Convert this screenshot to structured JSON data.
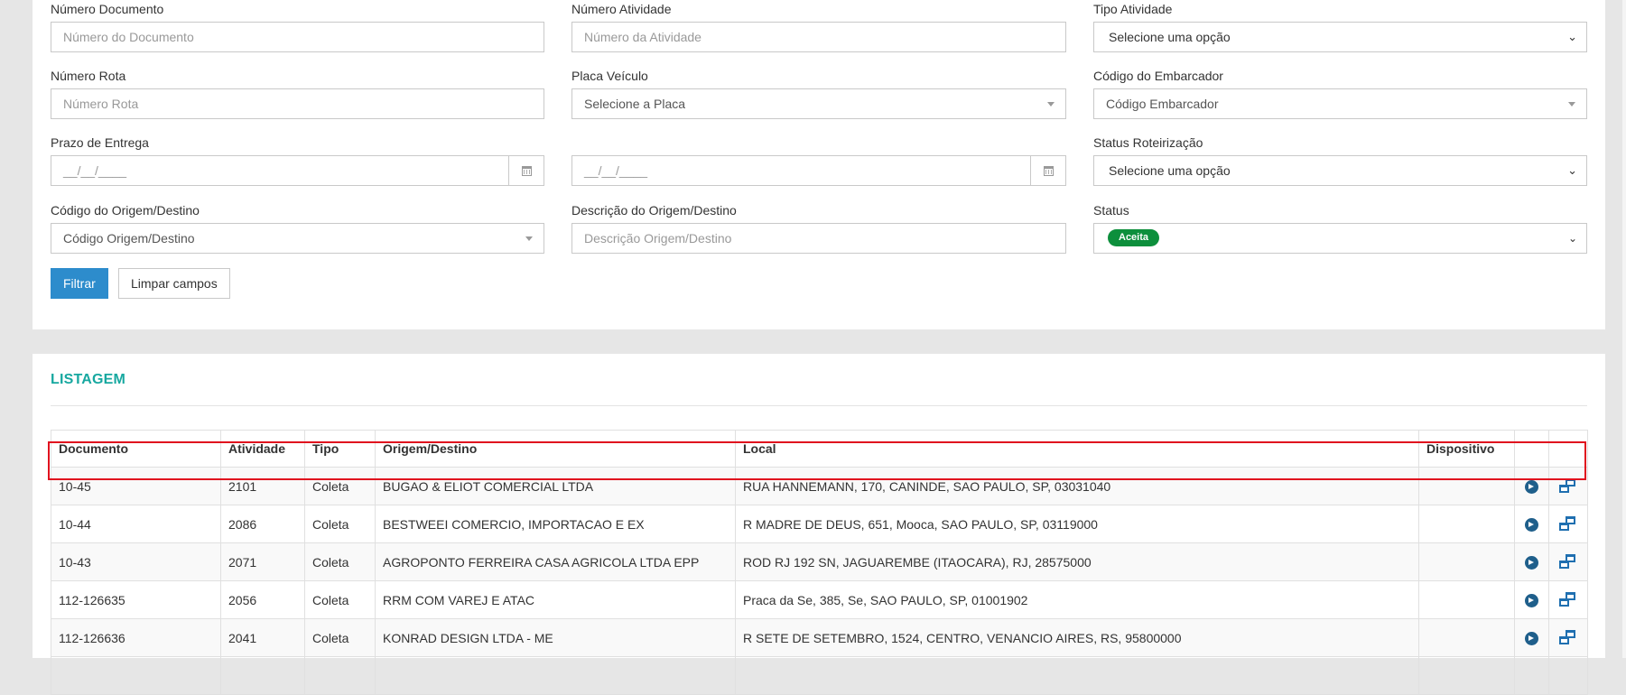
{
  "filters": {
    "numero_documento": {
      "label": "Número Documento",
      "placeholder": "Número do Documento"
    },
    "numero_atividade": {
      "label": "Número Atividade",
      "placeholder": "Número da Atividade"
    },
    "tipo_atividade": {
      "label": "Tipo Atividade",
      "value": "Selecione uma opção"
    },
    "numero_rota": {
      "label": "Número Rota",
      "placeholder": "Número Rota"
    },
    "placa_veiculo": {
      "label": "Placa Veículo",
      "value": "Selecione a Placa"
    },
    "codigo_embarcador": {
      "label": "Código do Embarcador",
      "value": "Código Embarcador"
    },
    "prazo_entrega": {
      "label": "Prazo de Entrega",
      "from": "__/__/____",
      "to": "__/__/____"
    },
    "status_roteirizacao": {
      "label": "Status Roteirização",
      "value": "Selecione uma opção"
    },
    "codigo_origem_destino": {
      "label": "Código do Origem/Destino",
      "value": "Código Origem/Destino"
    },
    "descricao_origem_destino": {
      "label": "Descrição do Origem/Destino",
      "placeholder": "Descrição Origem/Destino"
    },
    "status": {
      "label": "Status",
      "selected_tag": "Aceita"
    }
  },
  "buttons": {
    "filter": "Filtrar",
    "clear": "Limpar campos"
  },
  "listing": {
    "title": "LISTAGEM",
    "columns": [
      "Documento",
      "Atividade",
      "Tipo",
      "Origem/Destino",
      "Local",
      "Dispositivo",
      "",
      ""
    ],
    "rows": [
      {
        "documento": "10-45",
        "atividade": "2101",
        "tipo": "Coleta",
        "origem": "BUGAO & ELIOT COMERCIAL LTDA",
        "local": "RUA HANNEMANN, 170, CANINDE, SAO PAULO, SP, 03031040",
        "dispositivo": ""
      },
      {
        "documento": "10-44",
        "atividade": "2086",
        "tipo": "Coleta",
        "origem": "BESTWEEI COMERCIO, IMPORTACAO E EX",
        "local": "R MADRE DE DEUS, 651, Mooca, SAO PAULO, SP, 03119000",
        "dispositivo": ""
      },
      {
        "documento": "10-43",
        "atividade": "2071",
        "tipo": "Coleta",
        "origem": "AGROPONTO FERREIRA CASA AGRICOLA LTDA EPP",
        "local": "ROD RJ 192 SN, JAGUAREMBE (ITAOCARA), RJ, 28575000",
        "dispositivo": ""
      },
      {
        "documento": "112-126635",
        "atividade": "2056",
        "tipo": "Coleta",
        "origem": "RRM COM VAREJ E ATAC",
        "local": "Praca da Se, 385, Se, SAO PAULO, SP, 01001902",
        "dispositivo": ""
      },
      {
        "documento": "112-126636",
        "atividade": "2041",
        "tipo": "Coleta",
        "origem": "KONRAD DESIGN LTDA - ME",
        "local": "R SETE DE SETEMBRO, 1524, CENTRO, VENANCIO AIRES, RS, 95800000",
        "dispositivo": ""
      }
    ]
  },
  "colors": {
    "accent": "#2d8ccc",
    "title": "#17a8a0",
    "badge": "#0d8f3c",
    "highlight": "#e0101e"
  }
}
